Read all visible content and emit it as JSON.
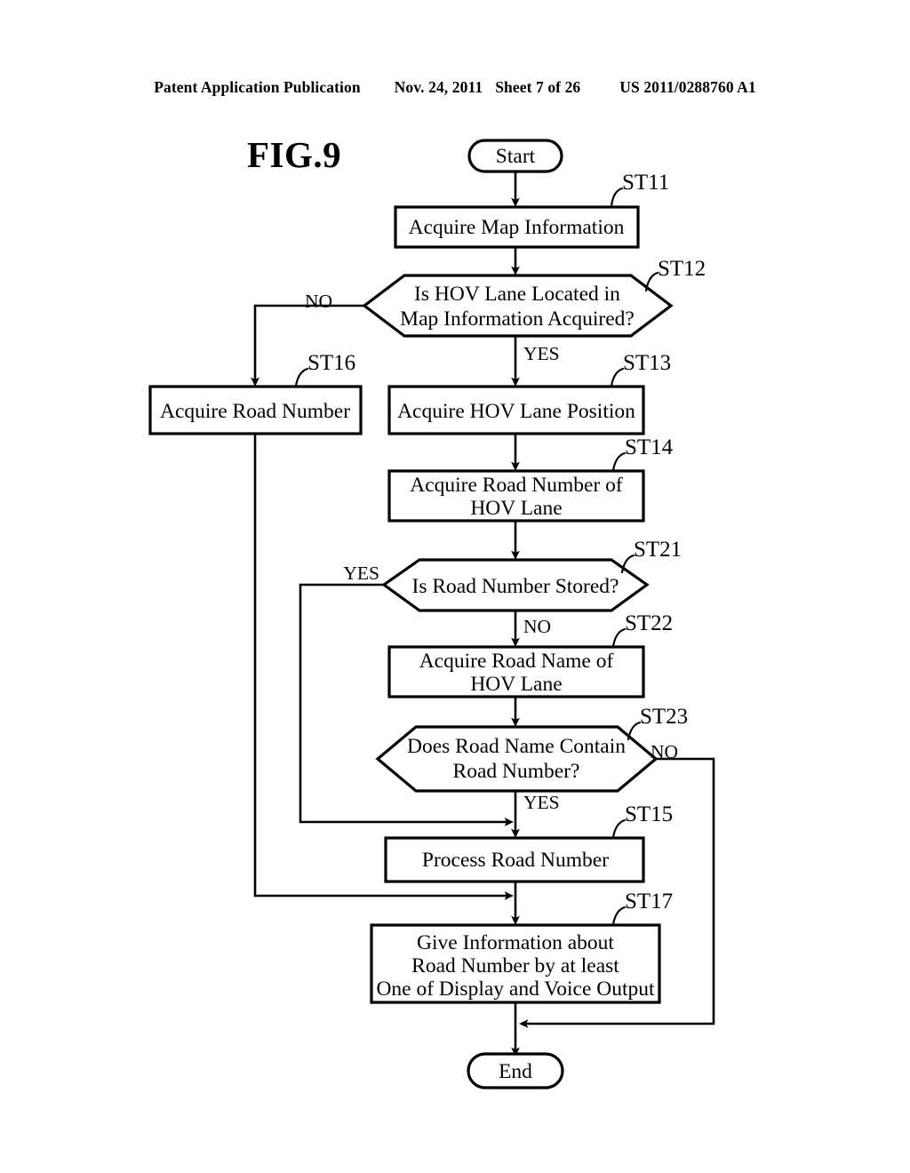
{
  "header": {
    "publication": "Patent Application Publication",
    "date": "Nov. 24, 2011",
    "sheet": "Sheet 7 of 26",
    "patent_number": "US 2011/0288760 A1"
  },
  "figure": {
    "title": "FIG.9"
  },
  "chart_data": {
    "type": "diagram",
    "title": "FIG.9",
    "diagram_type": "flowchart",
    "nodes": [
      {
        "id": "start",
        "shape": "terminator",
        "label": "Start",
        "step": ""
      },
      {
        "id": "ST11",
        "shape": "process",
        "label": "Acquire Map Information",
        "step": "ST11"
      },
      {
        "id": "ST12",
        "shape": "decision",
        "label": "Is HOV Lane Located in Map Information Acquired?",
        "step": "ST12"
      },
      {
        "id": "ST16",
        "shape": "process",
        "label": "Acquire Road Number",
        "step": "ST16"
      },
      {
        "id": "ST13",
        "shape": "process",
        "label": "Acquire HOV Lane Position",
        "step": "ST13"
      },
      {
        "id": "ST14",
        "shape": "process",
        "label": "Acquire Road Number of HOV Lane",
        "step": "ST14"
      },
      {
        "id": "ST21",
        "shape": "decision",
        "label": "Is Road Number Stored?",
        "step": "ST21"
      },
      {
        "id": "ST22",
        "shape": "process",
        "label": "Acquire Road Name of HOV Lane",
        "step": "ST22"
      },
      {
        "id": "ST23",
        "shape": "decision",
        "label": "Does Road Name Contain Road Number?",
        "step": "ST23"
      },
      {
        "id": "ST15",
        "shape": "process",
        "label": "Process Road Number",
        "step": "ST15"
      },
      {
        "id": "ST17",
        "shape": "process",
        "label": "Give Information about Road Number by at least One of Display and Voice Output",
        "step": "ST17"
      },
      {
        "id": "end",
        "shape": "terminator",
        "label": "End",
        "step": ""
      }
    ],
    "edges": [
      {
        "from": "start",
        "to": "ST11",
        "label": ""
      },
      {
        "from": "ST11",
        "to": "ST12",
        "label": ""
      },
      {
        "from": "ST12",
        "to": "ST16",
        "label": "NO"
      },
      {
        "from": "ST12",
        "to": "ST13",
        "label": "YES"
      },
      {
        "from": "ST13",
        "to": "ST14",
        "label": ""
      },
      {
        "from": "ST14",
        "to": "ST21",
        "label": ""
      },
      {
        "from": "ST21",
        "to": "ST15",
        "label": "YES"
      },
      {
        "from": "ST21",
        "to": "ST22",
        "label": "NO"
      },
      {
        "from": "ST22",
        "to": "ST23",
        "label": ""
      },
      {
        "from": "ST23",
        "to": "ST15",
        "label": "YES"
      },
      {
        "from": "ST23",
        "to": "end",
        "label": "NO"
      },
      {
        "from": "ST15",
        "to": "ST17",
        "label": ""
      },
      {
        "from": "ST16",
        "to": "ST17",
        "label": ""
      },
      {
        "from": "ST17",
        "to": "end",
        "label": ""
      }
    ]
  },
  "nodes": {
    "start": {
      "label": "Start"
    },
    "st11": {
      "label": "Acquire Map Information",
      "step": "ST11"
    },
    "st12": {
      "line1": "Is HOV Lane Located in",
      "line2": "Map Information Acquired?",
      "step": "ST12"
    },
    "st16": {
      "label": "Acquire Road Number",
      "step": "ST16"
    },
    "st13": {
      "label": "Acquire HOV Lane Position",
      "step": "ST13"
    },
    "st14": {
      "line1": "Acquire Road Number of",
      "line2": "HOV Lane",
      "step": "ST14"
    },
    "st21": {
      "label": "Is Road Number Stored?",
      "step": "ST21"
    },
    "st22": {
      "line1": "Acquire Road Name of",
      "line2": "HOV Lane",
      "step": "ST22"
    },
    "st23": {
      "line1": "Does Road Name Contain",
      "line2": "Road Number?",
      "step": "ST23"
    },
    "st15": {
      "label": "Process Road Number",
      "step": "ST15"
    },
    "st17": {
      "line1": "Give Information about",
      "line2": "Road Number by at least",
      "line3": "One of Display and Voice Output",
      "step": "ST17"
    },
    "end": {
      "label": "End"
    }
  },
  "branch_labels": {
    "st12_no": "NO",
    "st12_yes": "YES",
    "st21_yes": "YES",
    "st21_no": "NO",
    "st23_no": "NO",
    "st23_yes": "YES"
  },
  "colors": {
    "ink": "#000000",
    "paper": "#ffffff"
  }
}
